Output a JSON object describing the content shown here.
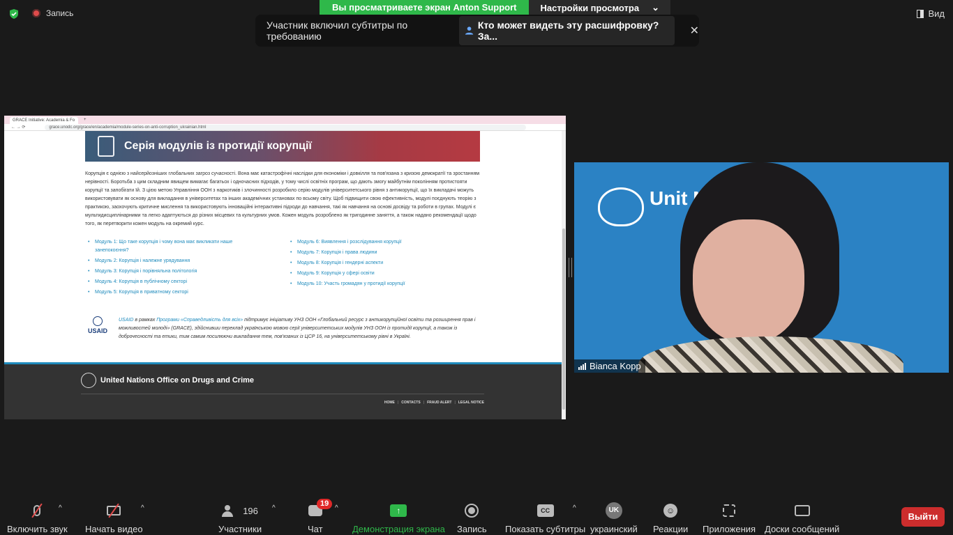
{
  "top": {
    "recording_label": "Запись",
    "share_banner": "Вы просматриваете экран Anton Support",
    "view_settings": "Настройки просмотра",
    "view_button": "Вид"
  },
  "notice": {
    "text": "Участник включил субтитры по требованию",
    "question": "Кто может видеть эту расшифровку? За...",
    "close": "✕"
  },
  "browser": {
    "tab_title": "GRACE Initiative: Academia & Fo",
    "url": "grace.unodc.org/grace/en/academia/module-series-on-anti-corruption_ukrainian.html"
  },
  "page": {
    "hero_title": "Серія модулів із протидії корупції",
    "intro": "Корупція є однією з найсерйозніших глобальних загроз сучасності. Вона має катастрофічні наслідки для економіки і довкілля та пов'язана з кризою демократії та зростанням нерівності. Боротьба з цим складним явищем вимагає багатьох і одночасних підходів, у тому числі освітніх програм, що дають змогу майбутнім поколінням протистояти корупції та запобігати їй. З цією метою Управління ООН з наркотиків і злочинності розробило серію модулів університетського рівня з антикорупції, що їх викладачі можуть використовувати як основу для викладання в університетах та інших академічних установах по всьому світу. Щоб підвищити свою ефективність, модулі поєднують теорію з практикою, заохочують критичне мислення та використовують інноваційні інтерактивні підходи до навчання, такі як навчання на основі досвіду та роботи в групах. Модулі є мультидисциплінарними та легко адаптуються до різних місцевих та культурних умов. Кожен модуль розроблено як тригодинне заняття, а також надано рекомендації щодо того, як перетворити кожен модуль на окремий курс.",
    "modules_left": [
      "Модуль 1: Що таке корупція і чому вона має викликати наше занепокоєння?",
      "Модуль 2: Корупція і належне урядування",
      "Модуль 3: Корупція і порівняльна політологія",
      "Модуль 4: Корупція в публічному секторі",
      "Модуль 5: Корупція в приватному секторі"
    ],
    "modules_right": [
      "Модуль 6: Виявлення і розслідування корупції",
      "Модуль 7: Корупція і права людини",
      "Модуль 8: Корупція і гендерні аспекти",
      "Модуль 9: Корупція у сфері освіти",
      "Модуль 10: Участь громадян у протидії корупції"
    ],
    "usaid_logo": "USAID",
    "usaid_link": "USAID",
    "usaid_mid": " в рамках ",
    "usaid_program": "Програми «Справедливість для всіх»",
    "usaid_rest": " підтримує ініціативу УНЗ ООН «Глобальний ресурс з антикорупційної освіти та розширення прав і можливостей молоді» (GRACE), здійснивши переклад українською мовою серії університетських модулів УНЗ ООН із протидії корупції, а також із доброчесності та етики, тим самим посилюючи викладання тем, пов'язаних із ЦСР 16, на університетському рівні в Україні.",
    "footer_org": "United Nations Office on Drugs and Crime",
    "footer_links": [
      "HOME",
      "CONTACTS",
      "FRAUD ALERT",
      "LEGAL NOTICE"
    ]
  },
  "video": {
    "bg_text": "Unit Nati",
    "participant_name": "Bianca Kopp"
  },
  "toolbar": {
    "mute": "Включить звук",
    "video": "Начать видео",
    "participants_count": "196",
    "participants": "Участники",
    "chat_badge": "19",
    "chat": "Чат",
    "share": "Демонстрация экрана",
    "record": "Запись",
    "captions": "Показать субтитры",
    "language_code": "UK",
    "language": "украинский",
    "reactions": "Реакции",
    "apps": "Приложения",
    "boards": "Доски сообщений",
    "leave": "Выйти"
  },
  "colors": {
    "share_green": "#2fb84a",
    "leave_red": "#cc2d2d",
    "link_blue": "#1f8bbd"
  }
}
